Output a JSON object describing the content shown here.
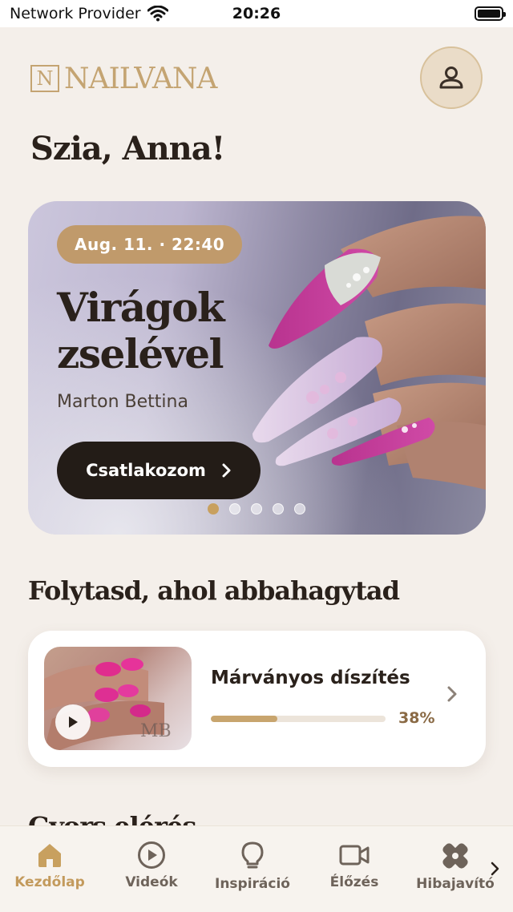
{
  "status_bar": {
    "carrier": "Network Provider",
    "time": "20:26"
  },
  "header": {
    "logo_text": "NAILVANA",
    "logo_mark": "N",
    "profile_icon": "person-icon"
  },
  "greeting": "Szia, Anna!",
  "hero": {
    "badge": "Aug. 11. · 22:40",
    "title": "Virágok zselével",
    "author": "Marton Bettina",
    "cta_label": "Csatlakozom",
    "slides_total": 5,
    "active_slide": 1
  },
  "continue_section": {
    "title": "Folytasd, ahol abbahagytad",
    "card": {
      "title": "Márványos díszítés",
      "progress": 0.38,
      "progress_label": "38%"
    }
  },
  "next_section": {
    "title": "Gyors elérés"
  },
  "tab_bar": {
    "items": [
      {
        "label": "Kezdőlap",
        "icon": "home-icon",
        "active": true
      },
      {
        "label": "Videók",
        "icon": "play-circle-icon",
        "active": false
      },
      {
        "label": "Inspiráció",
        "icon": "lightbulb-icon",
        "active": false
      },
      {
        "label": "Élőzés",
        "icon": "video-camera-icon",
        "active": false
      },
      {
        "label": "Hibajavító",
        "icon": "bandage-icon",
        "active": false
      }
    ]
  },
  "colors": {
    "background": "#f4efea",
    "accent_gold": "#c8a05f",
    "dark": "#231c17",
    "badge": "#c09a6b"
  }
}
